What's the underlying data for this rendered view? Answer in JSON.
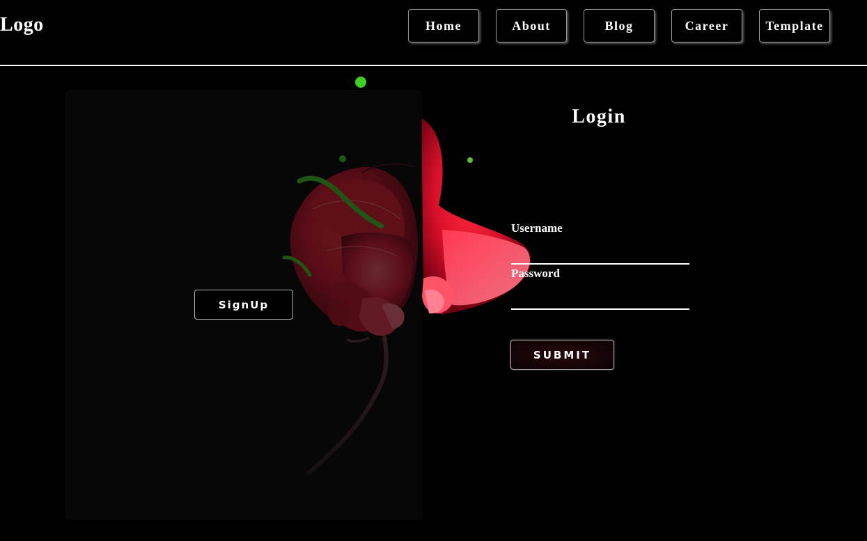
{
  "header": {
    "logo": "Logo",
    "nav": [
      {
        "label": "Home"
      },
      {
        "label": "About"
      },
      {
        "label": "Blog"
      },
      {
        "label": "Career"
      },
      {
        "label": "Template"
      }
    ]
  },
  "signup": {
    "button_label": "SignUp"
  },
  "login": {
    "title": "Login",
    "username_label": "Username",
    "username_value": "",
    "password_label": "Password",
    "password_value": "",
    "submit_label": "SUBMIT"
  },
  "colors": {
    "background": "#000000",
    "accent_rose": "#d8102a",
    "leaf_green": "#3fcf22"
  },
  "icons": {
    "background_art": "rose-flower-icon"
  }
}
